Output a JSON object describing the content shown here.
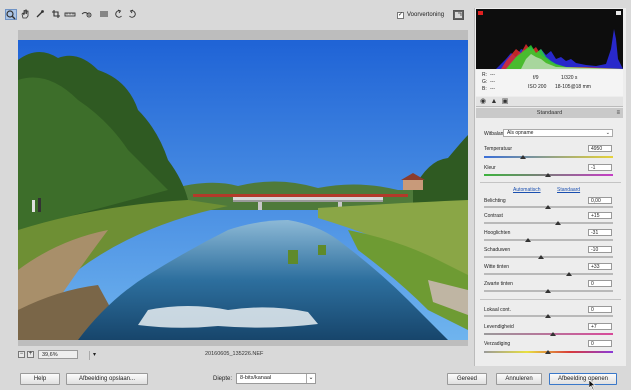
{
  "toolbar": {
    "tools": [
      {
        "name": "zoom-icon",
        "glyph": "🔍"
      },
      {
        "name": "hand-icon",
        "glyph": "✋"
      },
      {
        "name": "eyedropper-icon",
        "glyph": "✎"
      },
      {
        "name": "crop-icon",
        "glyph": "⌗"
      },
      {
        "name": "straighten-icon",
        "glyph": "⎯"
      },
      {
        "name": "redeye-icon",
        "glyph": "⊛"
      },
      {
        "name": "list-icon",
        "glyph": "≡"
      },
      {
        "name": "rotate-left-icon",
        "glyph": "↺"
      },
      {
        "name": "rotate-right-icon",
        "glyph": "↻"
      }
    ],
    "preview_label": "Voorvertoning",
    "preview_checked": "✓"
  },
  "image": {
    "filename": "20160605_135226.NEF",
    "zoom": "39,6%"
  },
  "readout": {
    "r_label": "R:",
    "g_label": "G:",
    "b_label": "B:",
    "r_value": "---",
    "g_value": "---",
    "b_value": "---",
    "aperture": "f/9",
    "shutter": "1/320 s",
    "iso": "ISO 200",
    "lens": "18-105@18 mm"
  },
  "panel": {
    "title": "Standaard",
    "wb_label": "Witbalans:",
    "wb_value": "Als opname",
    "temperature_label": "Temperatuur",
    "temperature_value": "4950",
    "tint_label": "Kleur",
    "tint_value": "-1",
    "auto_link": "Automatisch",
    "default_link": "Standaard",
    "sliders": [
      {
        "label": "Belichting",
        "value": "0,00"
      },
      {
        "label": "Contrast",
        "value": "+15"
      },
      {
        "label": "Hooglichten",
        "value": "-31"
      },
      {
        "label": "Schaduwen",
        "value": "-10"
      },
      {
        "label": "Witte tinten",
        "value": "+33"
      },
      {
        "label": "Zwarte tinten",
        "value": "0"
      }
    ],
    "presence": [
      {
        "label": "Lokaal cont.",
        "value": "0"
      },
      {
        "label": "Levendigheid",
        "value": "+7"
      },
      {
        "label": "Verzadiging",
        "value": "0"
      }
    ]
  },
  "footer": {
    "help": "Help",
    "save": "Afbeelding opslaan...",
    "depth_label": "Diepte:",
    "depth_value": "8-bits/kanaal",
    "done": "Gereed",
    "cancel": "Annuleren",
    "open": "Afbeelding openen"
  }
}
